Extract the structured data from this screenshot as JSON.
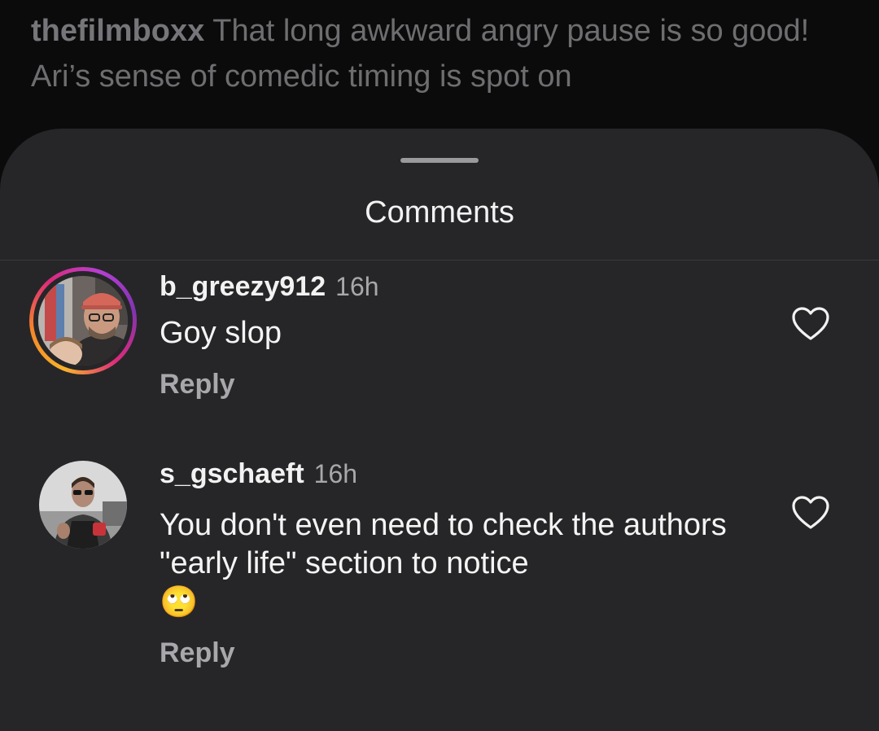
{
  "caption": {
    "username": "thefilmboxx",
    "text": "That long awkward angry pause is so good! Ari’s sense of comedic timing is spot on"
  },
  "sheet": {
    "title": "Comments"
  },
  "comments": [
    {
      "username": "b_greezy912",
      "time": "16h",
      "text": "Goy slop",
      "reply_label": "Reply",
      "avatar_has_story_ring": true
    },
    {
      "username": "s_gschaeft",
      "time": "16h",
      "text": "You don't even need to check the authors \"early life\" section to notice",
      "emoji": "🙄",
      "reply_label": "Reply",
      "avatar_has_story_ring": false
    }
  ],
  "icons": {
    "like": "heart-outline-icon",
    "drag": "drag-handle"
  },
  "colors": {
    "background": "#0b0b0c",
    "sheet": "#262628",
    "text_primary": "#f2f2f2",
    "text_secondary": "#a8a8ac"
  }
}
